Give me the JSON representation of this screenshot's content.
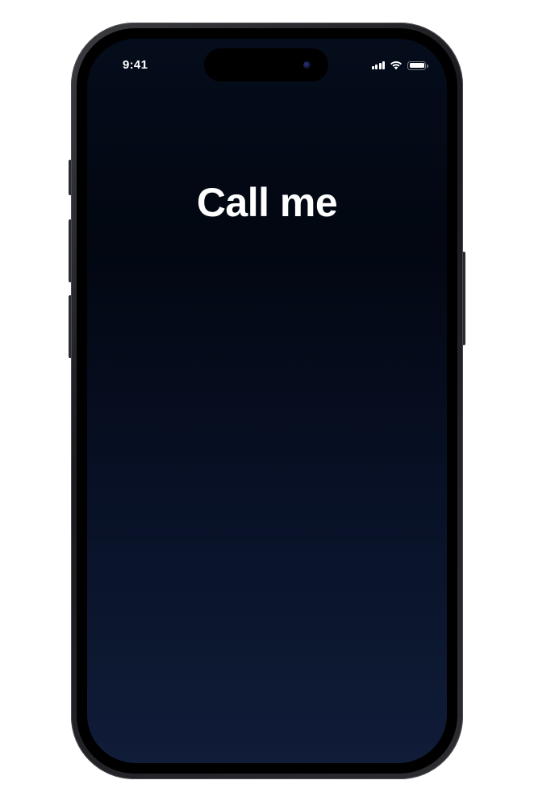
{
  "status_bar": {
    "time": "9:41",
    "icons": [
      "cellular-signal-icon",
      "wifi-icon",
      "battery-icon"
    ],
    "battery_level": 1.0
  },
  "main": {
    "title": "Call me"
  },
  "colors": {
    "screen_top": "#050c1b",
    "screen_bottom": "#101c38",
    "text": "#ffffff",
    "frame": "#1a1b1e"
  }
}
